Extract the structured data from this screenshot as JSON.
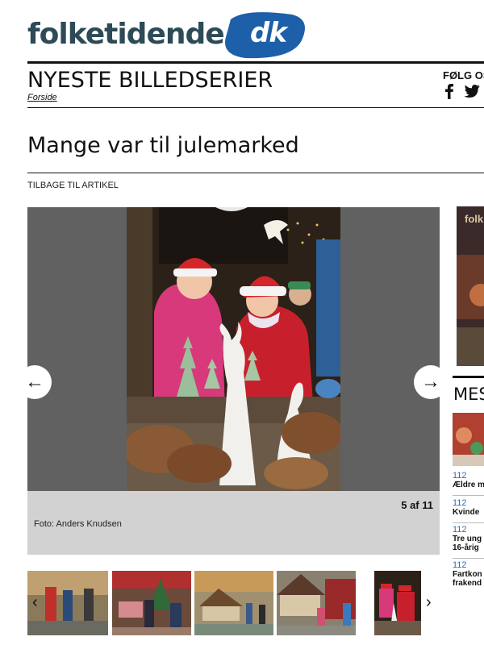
{
  "site": {
    "logo_main": "folketidende",
    "logo_badge": "dk"
  },
  "header": {
    "section_title": "NYESTE BILLEDSERIER",
    "breadcrumb": "Forside",
    "follow_label": "FØLG OS",
    "social_icons": [
      "facebook-icon",
      "twitter-icon"
    ]
  },
  "article": {
    "title": "Mange var til julemarked",
    "back_link": "TILBAGE TIL ARTIKEL"
  },
  "gallery": {
    "counter": "5 af 11",
    "caption": "Foto: Anders Knudsen",
    "prev_icon": "←",
    "next_icon": "→",
    "thumb_prev_icon": "‹",
    "thumb_next_icon": "›"
  },
  "sidebar": {
    "ad_text": "folk",
    "most_read_title": "MEST LÆSTE",
    "items": [
      {
        "category": "112",
        "headline": "Ældre m"
      },
      {
        "category": "112",
        "headline": "Kvinde"
      },
      {
        "category": "112",
        "headline": "Tre ung",
        "headline2": "16-årig"
      },
      {
        "category": "112",
        "headline": "Fartkon",
        "headline2": "frakend"
      }
    ]
  },
  "colors": {
    "brand": "#2d4a57",
    "badge": "#1d5fa8",
    "link": "#2a6ebb",
    "stage": "#616161",
    "caption_bg": "#d2d2d2"
  }
}
